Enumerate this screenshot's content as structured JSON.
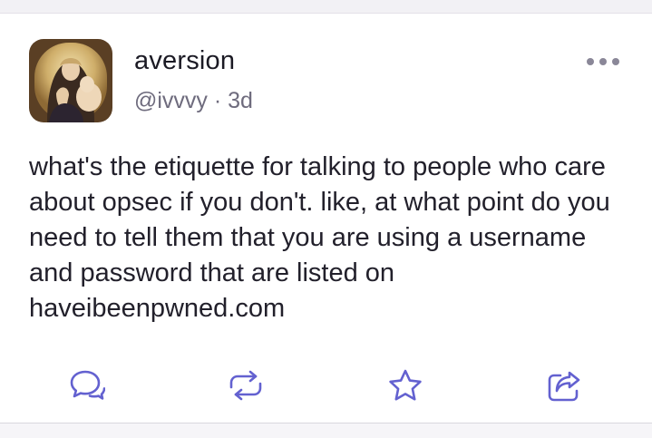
{
  "post": {
    "author": {
      "display_name": "aversion",
      "handle": "@ivvvy",
      "separator": " · ",
      "age": "3d"
    },
    "body": "what's the etiquette for talking to people who care about opsec if you don't. like, at what point do you need to tell them that you are using a username and password that are listed on haveibeenpwned.com"
  },
  "icons": {
    "more": "more-horizontal-icon",
    "reply": "reply-icon",
    "boost": "boost-icon",
    "favourite": "star-icon",
    "share": "share-icon"
  },
  "colors": {
    "text": "#22202b",
    "muted": "#6e6b7d",
    "icon": "#6361d0",
    "more_dots": "#8a8798"
  }
}
